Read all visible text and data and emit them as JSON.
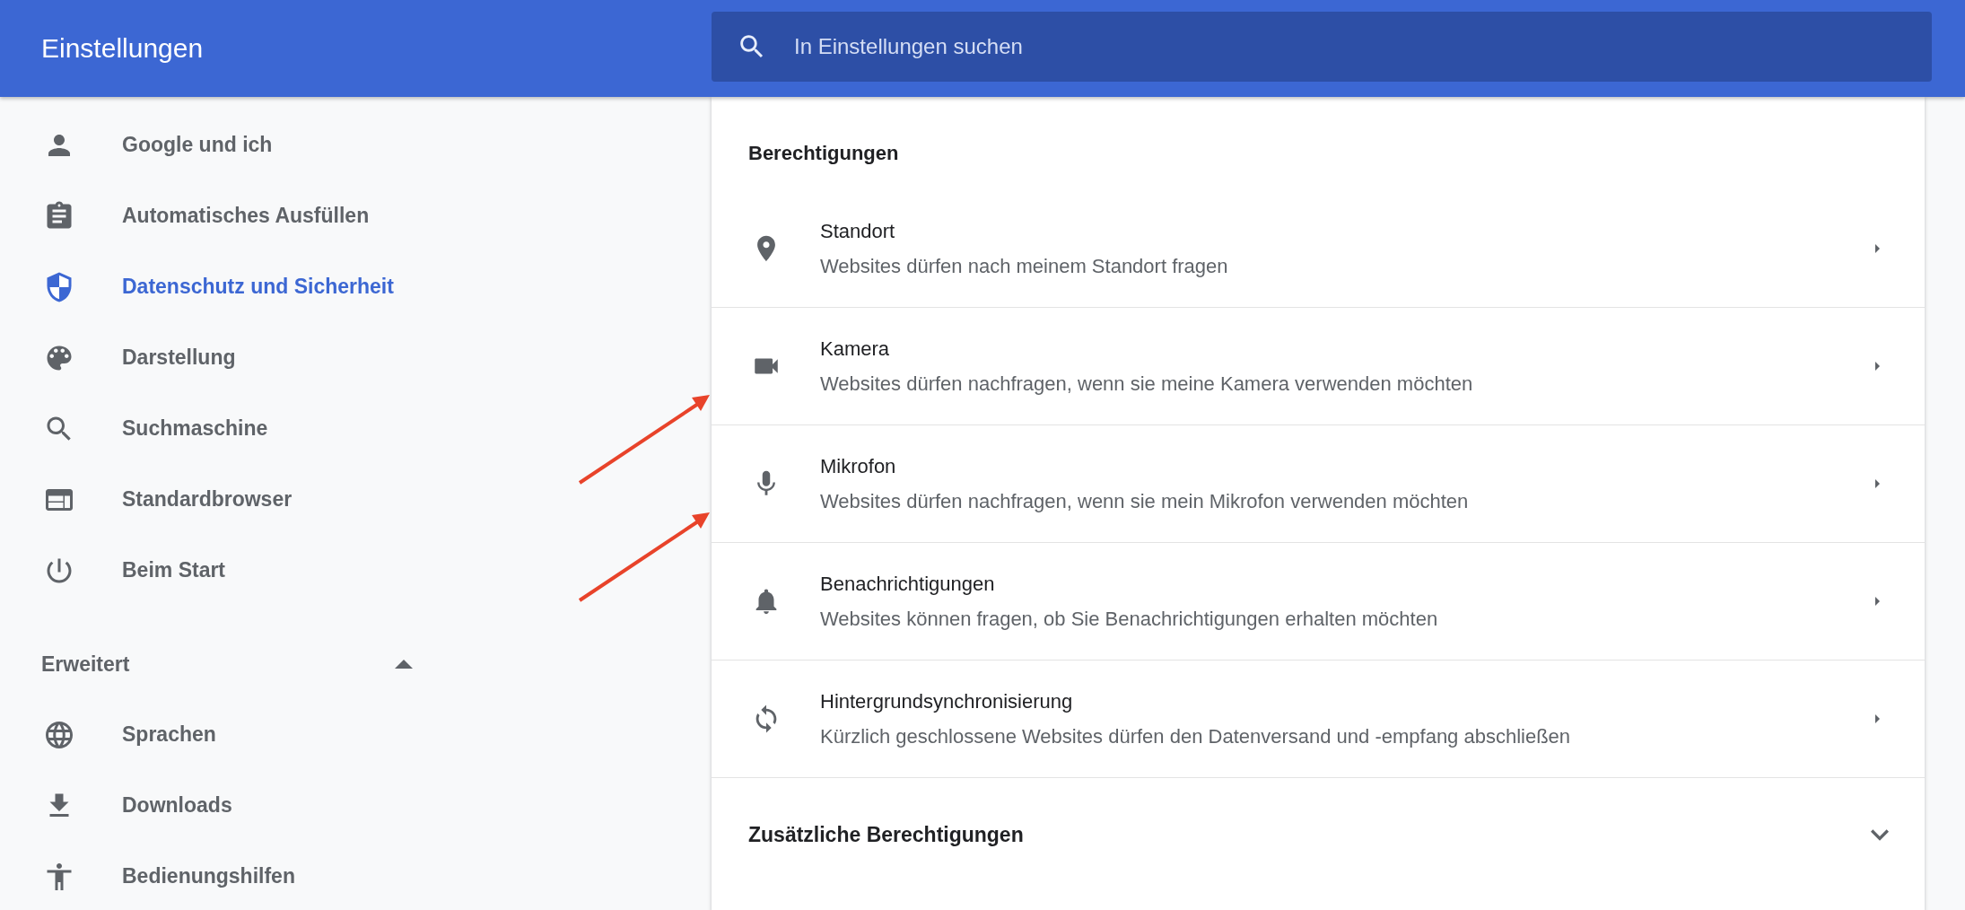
{
  "header": {
    "title": "Einstellungen",
    "search": {
      "placeholder": "In Einstellungen suchen"
    }
  },
  "sidebar": {
    "items": [
      {
        "label": "Google und ich",
        "selected": false
      },
      {
        "label": "Automatisches Ausfüllen",
        "selected": false
      },
      {
        "label": "Datenschutz und Sicherheit",
        "selected": true
      },
      {
        "label": "Darstellung",
        "selected": false
      },
      {
        "label": "Suchmaschine",
        "selected": false
      },
      {
        "label": "Standardbrowser",
        "selected": false
      },
      {
        "label": "Beim Start",
        "selected": false
      }
    ],
    "advanced": {
      "label": "Erweitert",
      "expanded": true,
      "items": [
        {
          "label": "Sprachen",
          "selected": false
        },
        {
          "label": "Downloads",
          "selected": false
        },
        {
          "label": "Bedienungshilfen",
          "selected": false
        }
      ]
    }
  },
  "permissions": {
    "title": "Berechtigungen",
    "rows": [
      {
        "title": "Standort",
        "description": "Websites dürfen nach meinem Standort fragen",
        "arrow_marked": false
      },
      {
        "title": "Kamera",
        "description": "Websites dürfen nachfragen, wenn sie meine Kamera verwenden möchten",
        "arrow_marked": true
      },
      {
        "title": "Mikrofon",
        "description": "Websites dürfen nachfragen, wenn sie mein Mikrofon verwenden möchten",
        "arrow_marked": true
      },
      {
        "title": "Benachrichtigungen",
        "description": "Websites können fragen, ob Sie Benachrichtigungen erhalten möchten",
        "arrow_marked": false
      },
      {
        "title": "Hintergrundsynchronisierung",
        "description": "Kürzlich geschlossene Websites dürfen den Datenversand und -empfang abschließen",
        "arrow_marked": false
      }
    ],
    "additional": {
      "label": "Zusätzliche Berechtigungen",
      "expanded": false
    }
  }
}
